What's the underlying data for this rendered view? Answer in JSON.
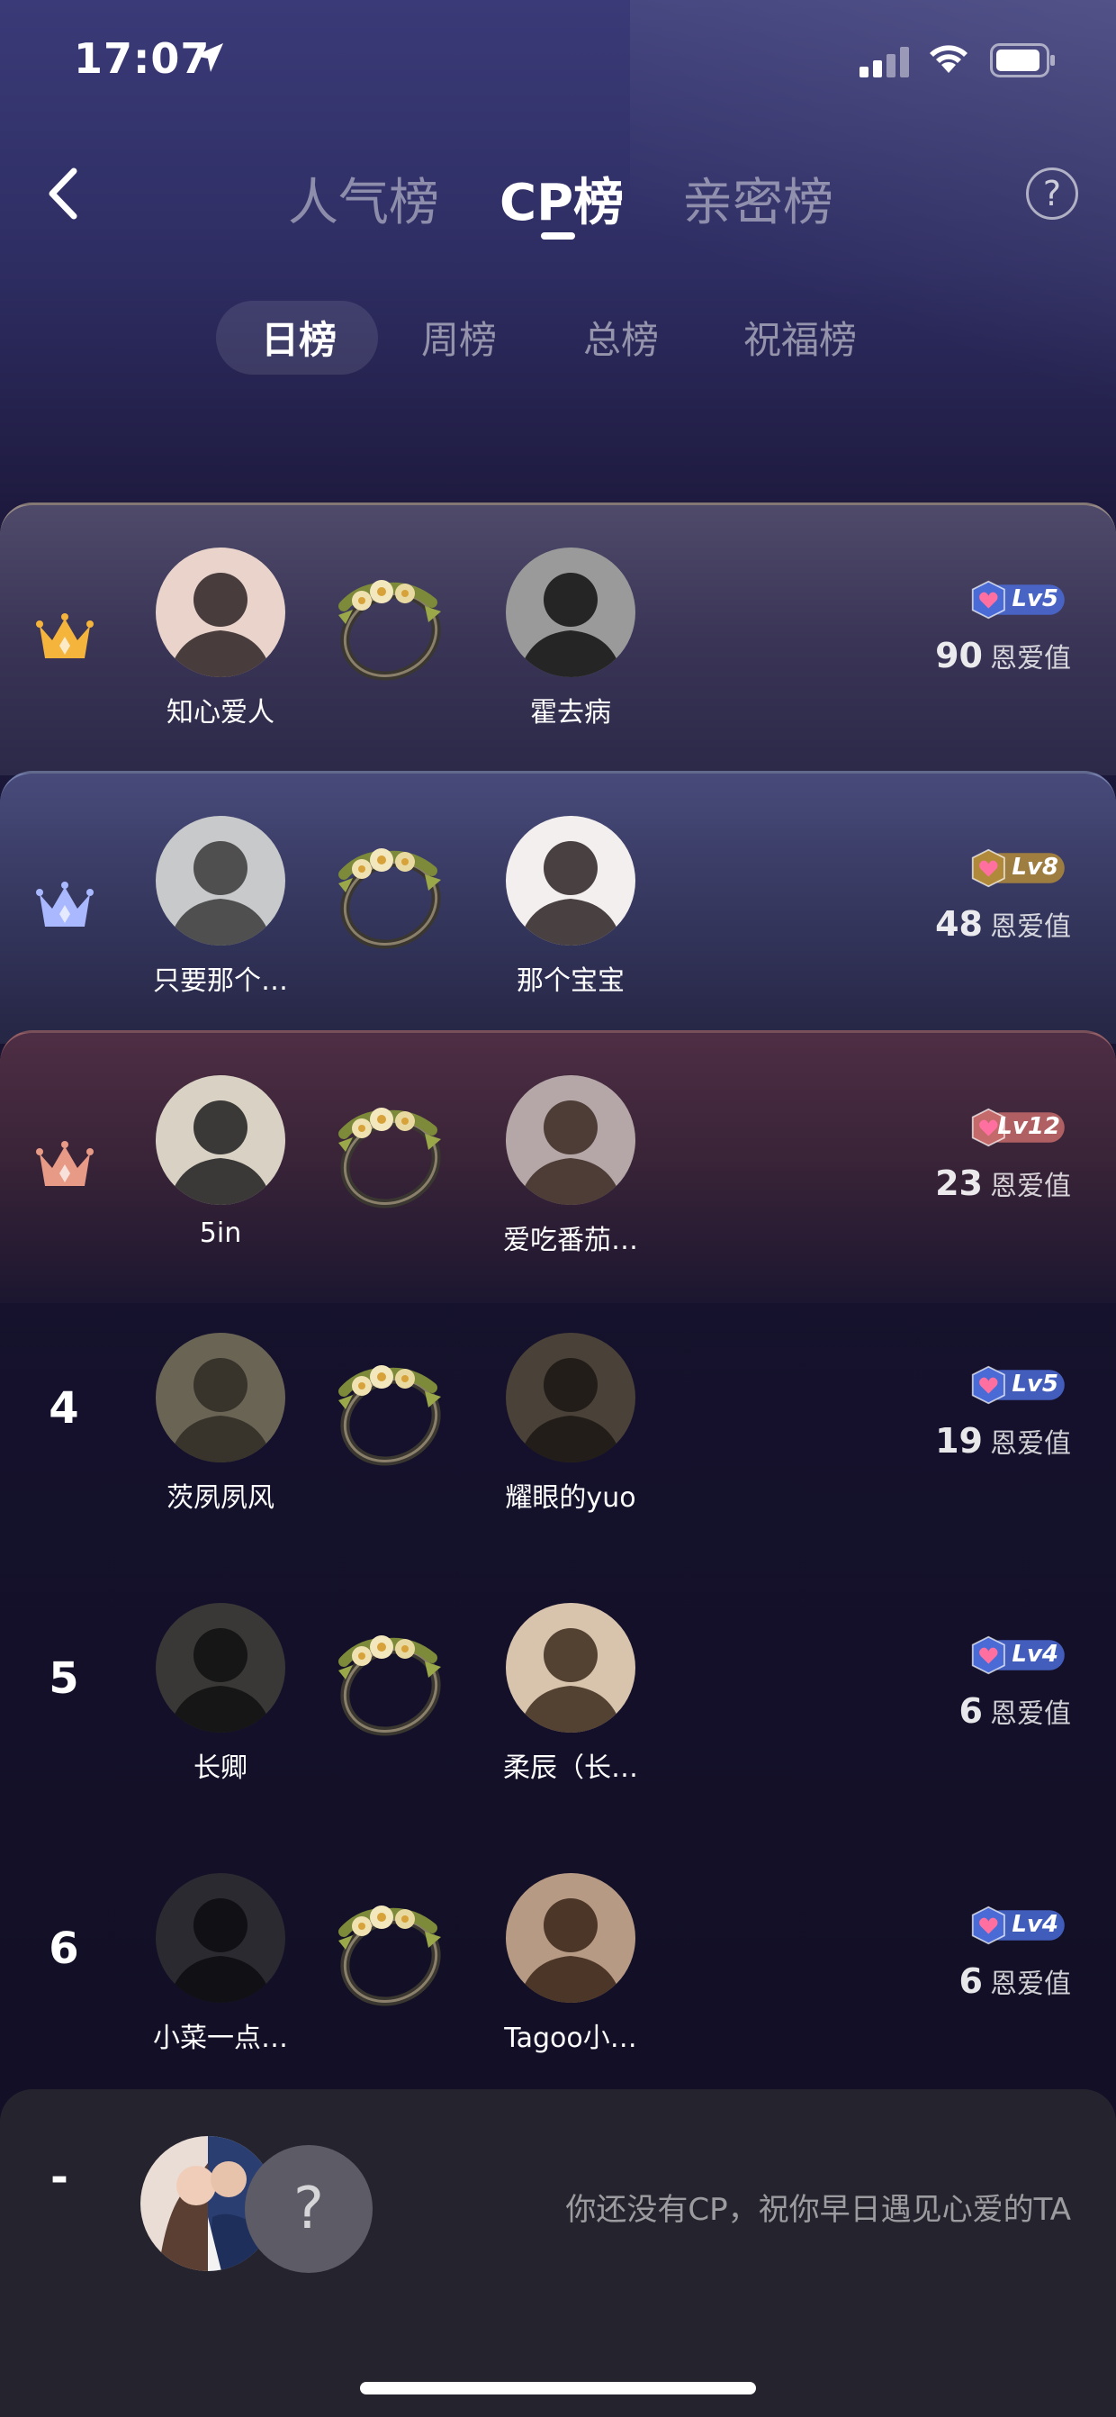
{
  "status_bar": {
    "time": "17:07"
  },
  "header": {
    "tabs": [
      {
        "label": "人气榜"
      },
      {
        "label": "CP榜"
      },
      {
        "label": "亲密榜"
      }
    ],
    "active_tab": "CP榜"
  },
  "subtabs": [
    {
      "label": "日榜"
    },
    {
      "label": "周榜"
    },
    {
      "label": "总榜"
    },
    {
      "label": "祝福榜"
    }
  ],
  "active_subtab": "日榜",
  "score_unit": "恩爱值",
  "rows": [
    {
      "rank": "1",
      "name1": "知心爱人",
      "name2": "霍去病",
      "level": "Lv5",
      "score": "90"
    },
    {
      "rank": "2",
      "name1": "只要那个…",
      "name2": "那个宝宝",
      "level": "Lv8",
      "score": "48"
    },
    {
      "rank": "3",
      "name1": "5in",
      "name2": "爱吃番茄…",
      "level": "Lv12",
      "score": "23"
    },
    {
      "rank": "4",
      "name1": "茨夙夙风",
      "name2": "耀眼的yuo",
      "level": "Lv5",
      "score": "19"
    },
    {
      "rank": "5",
      "name1": "长卿",
      "name2": "柔辰（长…",
      "level": "Lv4",
      "score": "6"
    },
    {
      "rank": "6",
      "name1": "小菜一点…",
      "name2": "Tagoo小…",
      "level": "Lv4",
      "score": "6"
    }
  ],
  "my_entry": {
    "rank": "-",
    "placeholder": "?",
    "message": "你还没有CP，祝你早日遇见心爱的TA"
  },
  "colors": {
    "crown_gold": "#f5b43c",
    "crown_silver": "#a9b8ff",
    "crown_bronze": "#e79a86",
    "badge_blue": "#4a6bd6",
    "badge_gold": "#b08a3a",
    "badge_red": "#c46a6a"
  }
}
